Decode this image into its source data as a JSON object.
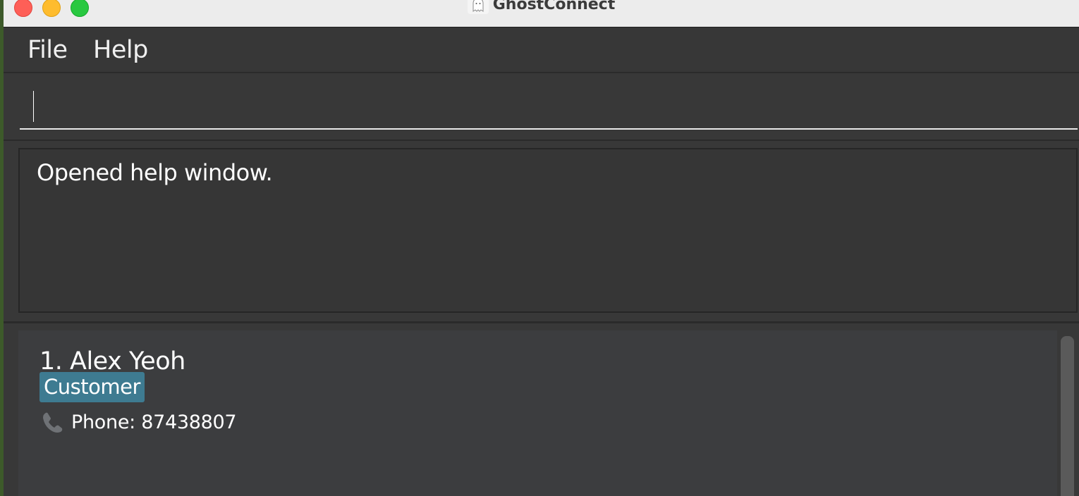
{
  "window": {
    "title": "GhostConnect"
  },
  "menu": {
    "file": "File",
    "help": "Help"
  },
  "command": {
    "value": ""
  },
  "result": {
    "message": "Opened help window."
  },
  "persons": [
    {
      "index_name": "1. Alex Yeoh",
      "tag": "Customer",
      "phone": "Phone: 87438807"
    }
  ],
  "colors": {
    "tag_background": "#3e7b91",
    "panel_background": "#373737",
    "card_background": "#3c3d3f"
  },
  "icons": {
    "app": "ghost-icon",
    "phone": "phone-icon"
  }
}
